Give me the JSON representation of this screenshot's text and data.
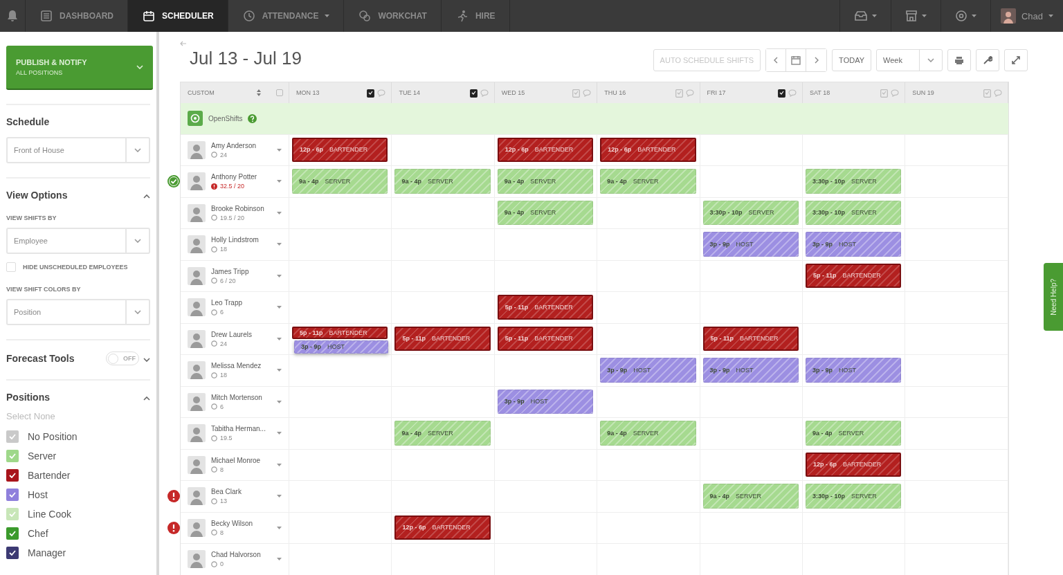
{
  "nav": {
    "items": [
      {
        "label": "DASHBOARD",
        "selected": false,
        "dropdown": false
      },
      {
        "label": "SCHEDULER",
        "selected": true,
        "dropdown": false
      },
      {
        "label": "ATTENDANCE",
        "selected": false,
        "dropdown": true
      },
      {
        "label": "WORKCHAT",
        "selected": false,
        "dropdown": false
      },
      {
        "label": "HIRE",
        "selected": false,
        "dropdown": false
      }
    ],
    "user": {
      "name": "Chad"
    }
  },
  "sidebar": {
    "publish": {
      "label": "PUBLISH & NOTIFY",
      "sublabel": "ALL POSITIONS"
    },
    "schedule": {
      "title": "Schedule",
      "value": "Front of House"
    },
    "view_options": {
      "title": "View Options",
      "expanded": true,
      "shifts_by_label": "VIEW SHIFTS BY",
      "shifts_by": "Employee",
      "hide_unscheduled": {
        "label": "HIDE UNSCHEDULED EMPLOYEES",
        "checked": false
      },
      "colors_by_label": "VIEW SHIFT COLORS BY",
      "colors_by": "Position"
    },
    "forecast": {
      "title": "Forecast Tools",
      "on": false,
      "toggle_label": "OFF",
      "expanded": false
    },
    "positions": {
      "title": "Positions",
      "expanded": true,
      "select_none": "Select None",
      "items": [
        {
          "label": "No Position",
          "color": "#c9c9c9",
          "checked": true
        },
        {
          "label": "Server",
          "color": "#9fd88a",
          "checked": true
        },
        {
          "label": "Bartender",
          "color": "#a8141b",
          "checked": true
        },
        {
          "label": "Host",
          "color": "#8f80dc",
          "checked": true
        },
        {
          "label": "Line Cook",
          "color": "#c8e6b8",
          "checked": true
        },
        {
          "label": "Chef",
          "color": "#3b9a2c",
          "checked": true
        },
        {
          "label": "Manager",
          "color": "#3c3a73",
          "checked": true
        }
      ]
    }
  },
  "title": "Jul 13 - Jul 19",
  "toolbar": {
    "auto_schedule": {
      "label": "AUTO SCHEDULE SHIFTS",
      "disabled": true
    },
    "today": "TODAY",
    "range": "Week"
  },
  "grid": {
    "sort_label": "CUSTOM",
    "days": [
      {
        "label": "MON 13",
        "published": true
      },
      {
        "label": "TUE 14",
        "published": true
      },
      {
        "label": "WED 15",
        "published": false
      },
      {
        "label": "THU 16",
        "published": false
      },
      {
        "label": "FRI 17",
        "published": true
      },
      {
        "label": "SAT 18",
        "published": false
      },
      {
        "label": "SUN 19",
        "published": false
      }
    ],
    "open_shifts": {
      "label": "OpenShifts"
    },
    "employees": [
      {
        "name": "Amy Anderson",
        "hours": "24",
        "over": false,
        "approved": false,
        "alert": false,
        "cells": [
          {
            "time": "12p - 6p",
            "role": "BARTENDER",
            "color": "#b3201f"
          },
          null,
          {
            "time": "12p - 6p",
            "role": "BARTENDER",
            "color": "#b3201f"
          },
          {
            "time": "12p - 6p",
            "role": "BARTENDER",
            "color": "#b3201f"
          },
          null,
          null,
          null
        ]
      },
      {
        "name": "Anthony Potter",
        "hours": "32.5 / 20",
        "over": true,
        "approved": true,
        "alert": false,
        "cells": [
          {
            "time": "9a - 4p",
            "role": "SERVER",
            "color": "#a6da90"
          },
          {
            "time": "9a - 4p",
            "role": "SERVER",
            "color": "#a6da90"
          },
          {
            "time": "9a - 4p",
            "role": "SERVER",
            "color": "#a6da90"
          },
          {
            "time": "9a - 4p",
            "role": "SERVER",
            "color": "#a6da90"
          },
          null,
          {
            "time": "3:30p - 10p",
            "role": "SERVER",
            "color": "#a6da90"
          },
          null
        ]
      },
      {
        "name": "Brooke Robinson",
        "hours": "19.5 / 20",
        "over": false,
        "approved": false,
        "alert": false,
        "cells": [
          null,
          null,
          {
            "time": "9a - 4p",
            "role": "SERVER",
            "color": "#a6da90"
          },
          null,
          {
            "time": "3:30p - 10p",
            "role": "SERVER",
            "color": "#a6da90"
          },
          {
            "time": "3:30p - 10p",
            "role": "SERVER",
            "color": "#a6da90"
          },
          null
        ]
      },
      {
        "name": "Holly Lindstrom",
        "hours": "18",
        "over": false,
        "approved": false,
        "alert": false,
        "cells": [
          null,
          null,
          null,
          null,
          {
            "time": "3p - 9p",
            "role": "HOST",
            "color": "#9c8fe2"
          },
          {
            "time": "3p - 9p",
            "role": "HOST",
            "color": "#9c8fe2"
          },
          null
        ]
      },
      {
        "name": "James Tripp",
        "hours": "6 / 20",
        "over": false,
        "approved": false,
        "alert": false,
        "cells": [
          null,
          null,
          null,
          null,
          null,
          {
            "time": "5p - 11p",
            "role": "BARTENDER",
            "color": "#b3201f"
          },
          null
        ]
      },
      {
        "name": "Leo Trapp",
        "hours": "6",
        "over": false,
        "approved": false,
        "alert": false,
        "cells": [
          null,
          null,
          {
            "time": "5p - 11p",
            "role": "BARTENDER",
            "color": "#b3201f"
          },
          null,
          null,
          null,
          null
        ]
      },
      {
        "name": "Drew Laurels",
        "hours": "24",
        "over": false,
        "approved": false,
        "alert": false,
        "cells": [
          {
            "time": "5p - 11p",
            "role": "BARTENDER",
            "color": "#b3201f",
            "drag": {
              "time": "3p - 9p",
              "role": "HOST",
              "color": "#9c8fe2"
            }
          },
          {
            "time": "5p - 11p",
            "role": "BARTENDER",
            "color": "#b3201f"
          },
          {
            "time": "5p - 11p",
            "role": "BARTENDER",
            "color": "#b3201f"
          },
          null,
          {
            "time": "5p - 11p",
            "role": "BARTENDER",
            "color": "#b3201f"
          },
          null,
          null
        ]
      },
      {
        "name": "Melissa Mendez",
        "hours": "18",
        "over": false,
        "approved": false,
        "alert": false,
        "cells": [
          null,
          null,
          null,
          {
            "time": "3p - 9p",
            "role": "HOST",
            "color": "#9c8fe2"
          },
          {
            "time": "3p - 9p",
            "role": "HOST",
            "color": "#9c8fe2"
          },
          {
            "time": "3p - 9p",
            "role": "HOST",
            "color": "#9c8fe2"
          },
          null
        ]
      },
      {
        "name": "Mitch Mortenson",
        "hours": "6",
        "over": false,
        "approved": false,
        "alert": false,
        "cells": [
          null,
          null,
          {
            "time": "3p - 9p",
            "role": "HOST",
            "color": "#9c8fe2"
          },
          null,
          null,
          null,
          null
        ]
      },
      {
        "name": "Tabitha Herman...",
        "hours": "19.5",
        "over": false,
        "approved": false,
        "alert": false,
        "cells": [
          null,
          {
            "time": "9a - 4p",
            "role": "SERVER",
            "color": "#a6da90"
          },
          null,
          {
            "time": "9a - 4p",
            "role": "SERVER",
            "color": "#a6da90"
          },
          null,
          {
            "time": "9a - 4p",
            "role": "SERVER",
            "color": "#a6da90"
          },
          null
        ]
      },
      {
        "name": "Michael Monroe",
        "hours": "8",
        "over": false,
        "approved": false,
        "alert": false,
        "cells": [
          null,
          null,
          null,
          null,
          null,
          {
            "time": "12p - 6p",
            "role": "BARTENDER",
            "color": "#b3201f"
          },
          null
        ]
      },
      {
        "name": "Bea Clark",
        "hours": "13",
        "over": false,
        "approved": false,
        "alert": true,
        "cells": [
          null,
          null,
          null,
          null,
          {
            "time": "9a - 4p",
            "role": "SERVER",
            "color": "#a6da90"
          },
          {
            "time": "3:30p - 10p",
            "role": "SERVER",
            "color": "#a6da90"
          },
          null
        ]
      },
      {
        "name": "Becky Wilson",
        "hours": "8",
        "over": false,
        "approved": false,
        "alert": true,
        "cells": [
          null,
          {
            "time": "12p - 6p",
            "role": "BARTENDER",
            "color": "#b3201f"
          },
          null,
          null,
          null,
          null,
          null
        ]
      },
      {
        "name": "Chad Halvorson",
        "hours": "0",
        "over": false,
        "approved": false,
        "alert": false,
        "cells": [
          null,
          null,
          null,
          null,
          null,
          null,
          null
        ]
      }
    ]
  },
  "help_tab": {
    "label": "Need Help?"
  }
}
